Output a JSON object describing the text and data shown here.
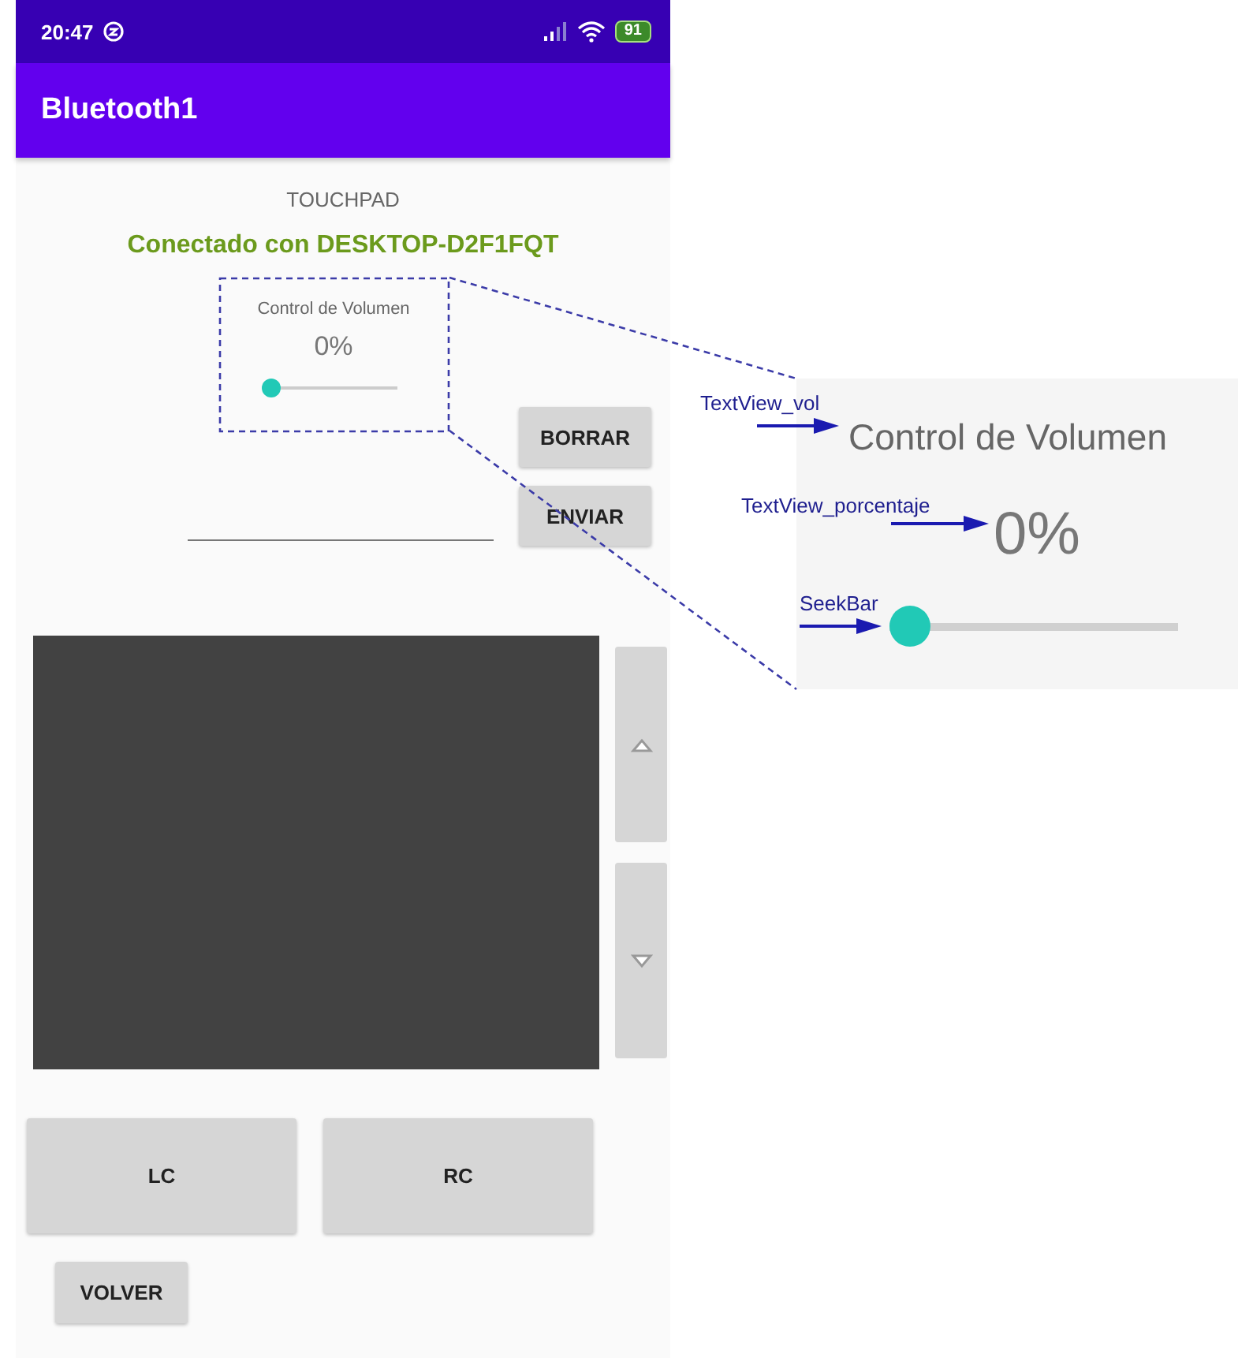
{
  "status_bar": {
    "time": "20:47",
    "battery": "91"
  },
  "app_bar": {
    "title": "Bluetooth1"
  },
  "screen": {
    "heading": "TOUCHPAD",
    "connection": "Conectado con DESKTOP-D2F1FQT",
    "volume": {
      "label": "Control de Volumen",
      "percentage": "0%",
      "level": 0
    },
    "buttons": [
      "BORRAR",
      "ENVIAR"
    ],
    "click_buttons": [
      "LC",
      "RC"
    ],
    "back_button": "VOLVER"
  },
  "annotation": {
    "labels": [
      {
        "kind": "text",
        "tag": "TextView_vol",
        "text": "Control de Volumen"
      },
      {
        "kind": "percent",
        "tag": "TextView_porcentaje",
        "text": "0%"
      },
      {
        "kind": "slider",
        "tag": "SeekBar",
        "level": 0
      }
    ]
  }
}
